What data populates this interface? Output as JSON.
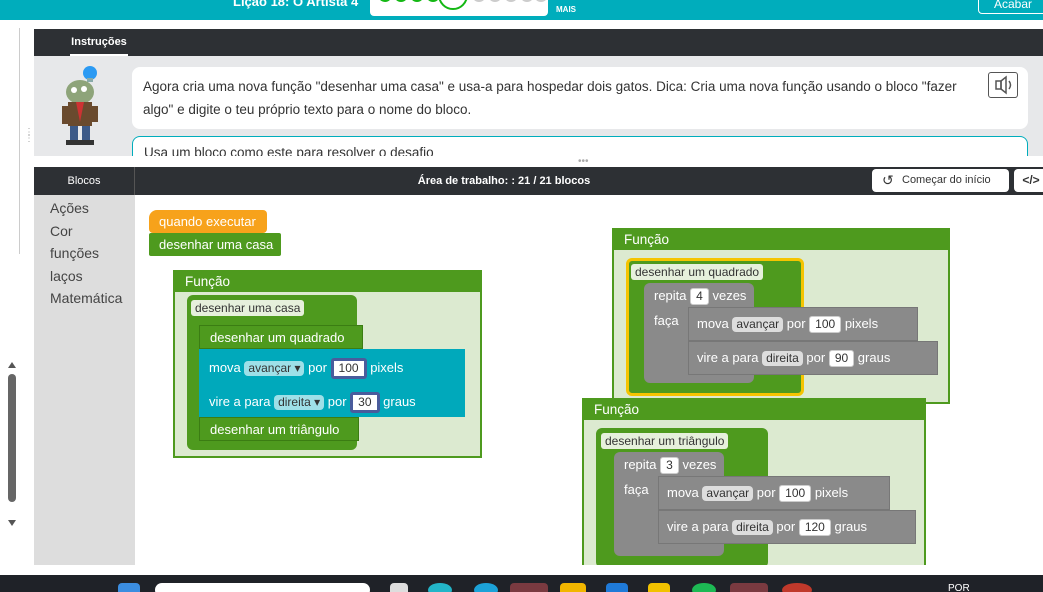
{
  "header": {
    "lesson_title": "Lição 18: O Artista 4",
    "progress": {
      "completed": 4,
      "current_label": "5",
      "remaining": 5
    },
    "more_label": "MAIS",
    "finish_label": "Acabar"
  },
  "instructions": {
    "tab_label": "Instruções",
    "text": "Agora cria uma nova função \"desenhar uma casa\" e usa-a para hospedar dois gatos. Dica: Cria uma nova função usando o bloco \"fazer algo\" e digite o teu próprio texto para o nome do bloco.",
    "hint_text": "Usa um bloco como este para resolver o desafio"
  },
  "toolbox": {
    "header": "Blocos",
    "categories": [
      "Ações",
      "Cor",
      "funções",
      "laços",
      "Matemática"
    ]
  },
  "workspace": {
    "header": "Área de trabalho: : 21 / 21 blocos",
    "restart_label": "Começar do início",
    "code_label": "</>"
  },
  "blocks": {
    "when_run": "quando executar",
    "call_house": "desenhar uma casa",
    "function_label": "Função",
    "f1_name": "desenhar uma casa",
    "f1_call_square": "desenhar um quadrado",
    "f1_move": "mova",
    "f1_move_dir": "avançar",
    "f1_by": "por",
    "f1_move_value": "100",
    "f1_pixels": "pixels",
    "f1_turn": "vire a",
    "f1_to": "para",
    "f1_turn_dir": "direita",
    "f1_turn_value": "30",
    "f1_degrees": "graus",
    "f1_call_triangle": "desenhar um triângulo",
    "f2_name": "desenhar um quadrado",
    "f2_repeat": "repita",
    "f2_repeat_count": "4",
    "f2_times": "vezes",
    "f2_do": "faça",
    "f2_move_value": "100",
    "f2_turn_value": "90",
    "f3_name": "desenhar um triângulo",
    "f3_repeat_count": "3",
    "f3_move_value": "100",
    "f3_turn_value": "120"
  },
  "taskbar": {
    "lang": "POR"
  },
  "colors": {
    "teal": "#00adbc",
    "orange": "#f7a21b",
    "green": "#4e9a1e",
    "light_green": "#dcead0",
    "cyan": "#00a9bb",
    "gray": "#8a8a8a",
    "dark": "#2d3034"
  }
}
